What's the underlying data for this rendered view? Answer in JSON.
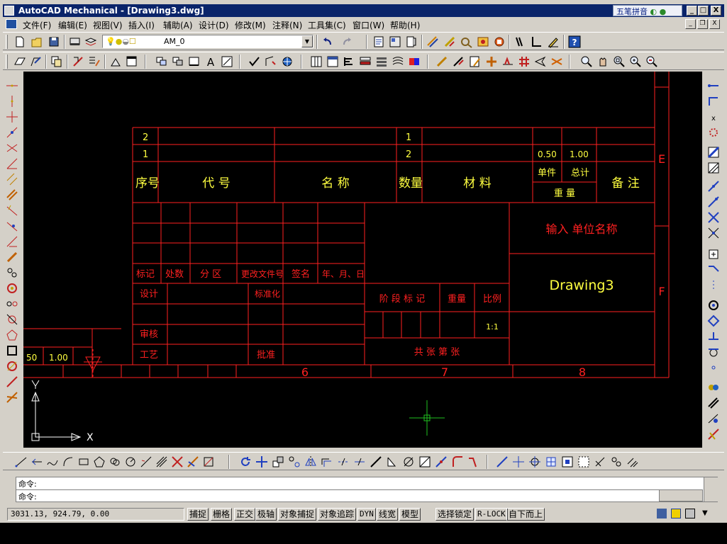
{
  "window": {
    "title": "AutoCAD Mechanical - [Drawing3.dwg]",
    "ime_label": "五笔拼音",
    "btn_minimize": "_",
    "btn_maximize": "□",
    "btn_close": "X"
  },
  "menu": {
    "items": [
      "文件(F)",
      "编辑(E)",
      "视图(V)",
      "插入(I)",
      "辅助(A)",
      "设计(D)",
      "修改(M)",
      "注释(N)",
      "工具集(C)",
      "窗口(W)",
      "帮助(H)"
    ],
    "mdi_minimize": "_",
    "mdi_restore": "❐",
    "mdi_close": "X"
  },
  "layer": {
    "current": "AM_0",
    "dropdown_arrow": "▼"
  },
  "drawing": {
    "parts_table": {
      "rows": [
        {
          "index": "2",
          "code": "",
          "name": "",
          "qty": "1",
          "material": "",
          "unit_weight": "",
          "total_weight": "",
          "note": ""
        },
        {
          "index": "1",
          "code": "",
          "name": "",
          "qty": "2",
          "material": "",
          "unit_weight": "0.50",
          "total_weight": "1.00",
          "note": ""
        }
      ],
      "headers": {
        "index": "序号",
        "code": "代    号",
        "name": "名    称",
        "qty": "数量",
        "material": "材    料",
        "unit": "单件",
        "total": "总计",
        "weight": "重    量",
        "note": "备 注"
      }
    },
    "title_block": {
      "revision_labels": [
        "标记",
        "处数",
        "分  区",
        "更改文件号",
        "签名",
        "年、月、日"
      ],
      "design": "设计",
      "standardize": "标准化",
      "review": "审核",
      "process": "工艺",
      "approve": "批准",
      "stage_mark": "阶 段 标 记",
      "weight": "重量",
      "scale": "比例",
      "scale_value": "1:1",
      "sheet_info": "共    张    第    张",
      "company": "输入 单位名称",
      "drawing_name": "Drawing3"
    },
    "left_block": {
      "qty": "50",
      "weight": "1.00"
    },
    "zone_numbers": [
      "6",
      "7",
      "8"
    ],
    "zone_letters": [
      "E",
      "F"
    ],
    "ucs": {
      "x": "X",
      "y": "Y"
    }
  },
  "command": {
    "line1": "命令:",
    "line2": "命令:"
  },
  "status": {
    "coords": "3031.13, 924.79, 0.00",
    "toggles": [
      "捕捉",
      "栅格",
      "正交",
      "极轴",
      "对象捕捉",
      "对象追踪",
      "DYN",
      "线宽",
      "模型"
    ],
    "lock": "选择锁定",
    "rlock": "R-LOCK",
    "order": "自下而上"
  },
  "colors": {
    "line": "#ff2020",
    "text": "#ffff40",
    "cursor": "#20c020",
    "canvas": "#000000"
  }
}
